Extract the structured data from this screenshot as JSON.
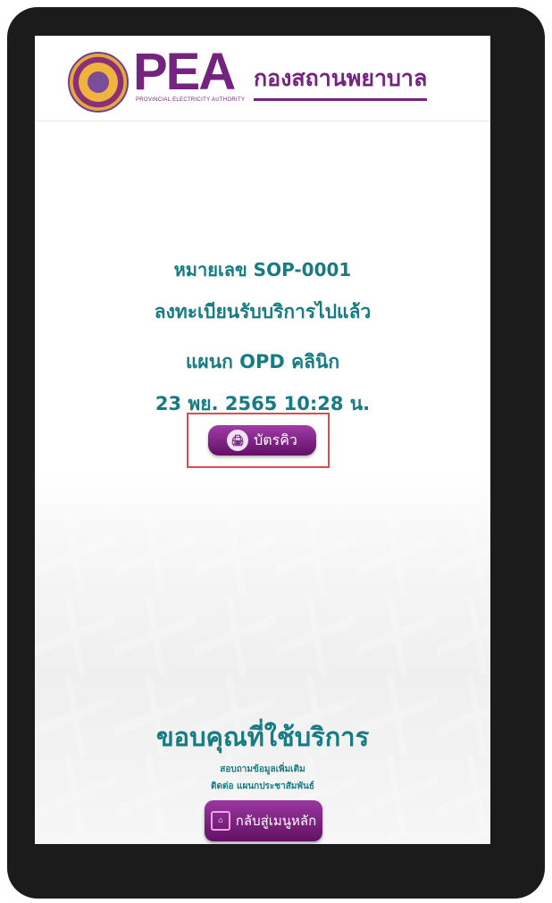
{
  "header": {
    "logo_text": "PEA",
    "logo_subtitle": "PROVINCIAL ELECTRICITY AUTHORITY",
    "title": "กองสถานพยาบาล"
  },
  "main": {
    "queue_number": "หมายเลข  SOP-0001",
    "status": "ลงทะเบียนรับบริการไปแล้ว",
    "department": "แผนก OPD  คลินิก",
    "datetime": "23 พย. 2565 10:28 น.",
    "ticket_button": "บัตรคิว"
  },
  "footer": {
    "thanks": "ขอบคุณที่ใช้บริการ",
    "contact_line1": "สอบถามข้อมูลเพิ่มเติม",
    "contact_line2": "ติดต่อ แผนกประชาสัมพันธ์",
    "home_button": "กลับสู่เมนูหลัก"
  },
  "icons": {
    "ticket_icon": "printer-icon",
    "home_icon": "home-icon"
  },
  "colors": {
    "brand_purple": "#74237f",
    "teal": "#167c84",
    "highlight": "#e04b4b"
  }
}
